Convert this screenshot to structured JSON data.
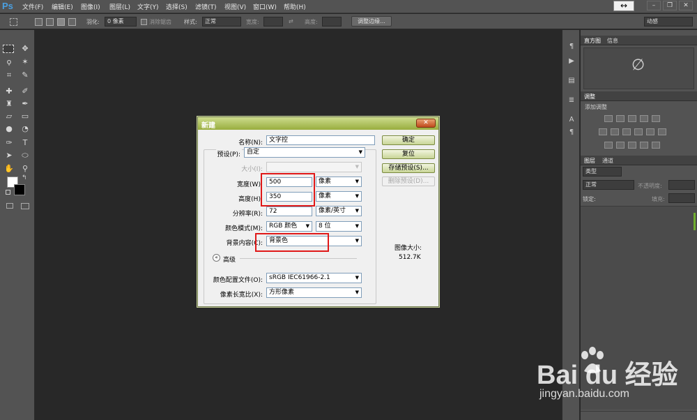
{
  "app": {
    "logo": "Ps"
  },
  "menu": [
    "文件(F)",
    "编辑(E)",
    "图像(I)",
    "图层(L)",
    "文字(Y)",
    "选择(S)",
    "滤镜(T)",
    "视图(V)",
    "窗口(W)",
    "帮助(H)"
  ],
  "window_controls": {
    "arrow": "↔",
    "minimize": "–",
    "restore": "❐",
    "close": "✕"
  },
  "options_bar": {
    "feather_label": "羽化:",
    "feather_value": "0 像素",
    "antialias_label": "消除锯齿",
    "style_label": "样式:",
    "style_value": "正常",
    "width_label": "宽度:",
    "height_label": "高度:",
    "refine_button": "调整边缘...",
    "workspace_value": "动感"
  },
  "panels": {
    "histogram_tab": "直方图",
    "info_tab": "信息",
    "histogram_symbol": "∅",
    "adjustments_tab": "调整",
    "add_adjustment": "添加调整",
    "layers_tab": "图层",
    "channels_tab": "通道",
    "kind_label": "类型",
    "blend_mode": "正常",
    "opacity_label": "不透明度:",
    "lock_label": "锁定:",
    "fill_label": "填充:"
  },
  "dialog": {
    "title": "新建",
    "close": "✕",
    "name_label": "名称(N):",
    "name_value": "文字控",
    "preset_label": "预设(P):",
    "preset_value": "自定",
    "size_label": "大小(I):",
    "width_label": "宽度(W):",
    "width_value": "500",
    "width_unit": "像素",
    "height_label": "高度(H):",
    "height_value": "350",
    "height_unit": "像素",
    "resolution_label": "分辨率(R):",
    "resolution_value": "72",
    "resolution_unit": "像素/英寸",
    "color_mode_label": "颜色模式(M):",
    "color_mode_value": "RGB 颜色",
    "bit_depth_value": "8 位",
    "background_label": "背景内容(C):",
    "background_value": "背景色",
    "advanced_label": "高级",
    "profile_label": "颜色配置文件(O):",
    "profile_value": "sRGB IEC61966-2.1",
    "aspect_label": "像素长宽比(X):",
    "aspect_value": "方形像素",
    "ok_button": "确定",
    "reset_button": "复位",
    "save_preset_button": "存储预设(S)...",
    "delete_preset_button": "删除预设(D)...",
    "image_size_label": "图像大小:",
    "image_size_value": "512.7K"
  },
  "watermark": {
    "brand_text": "Bai  du 经验",
    "url": "jingyan.baidu.com"
  }
}
